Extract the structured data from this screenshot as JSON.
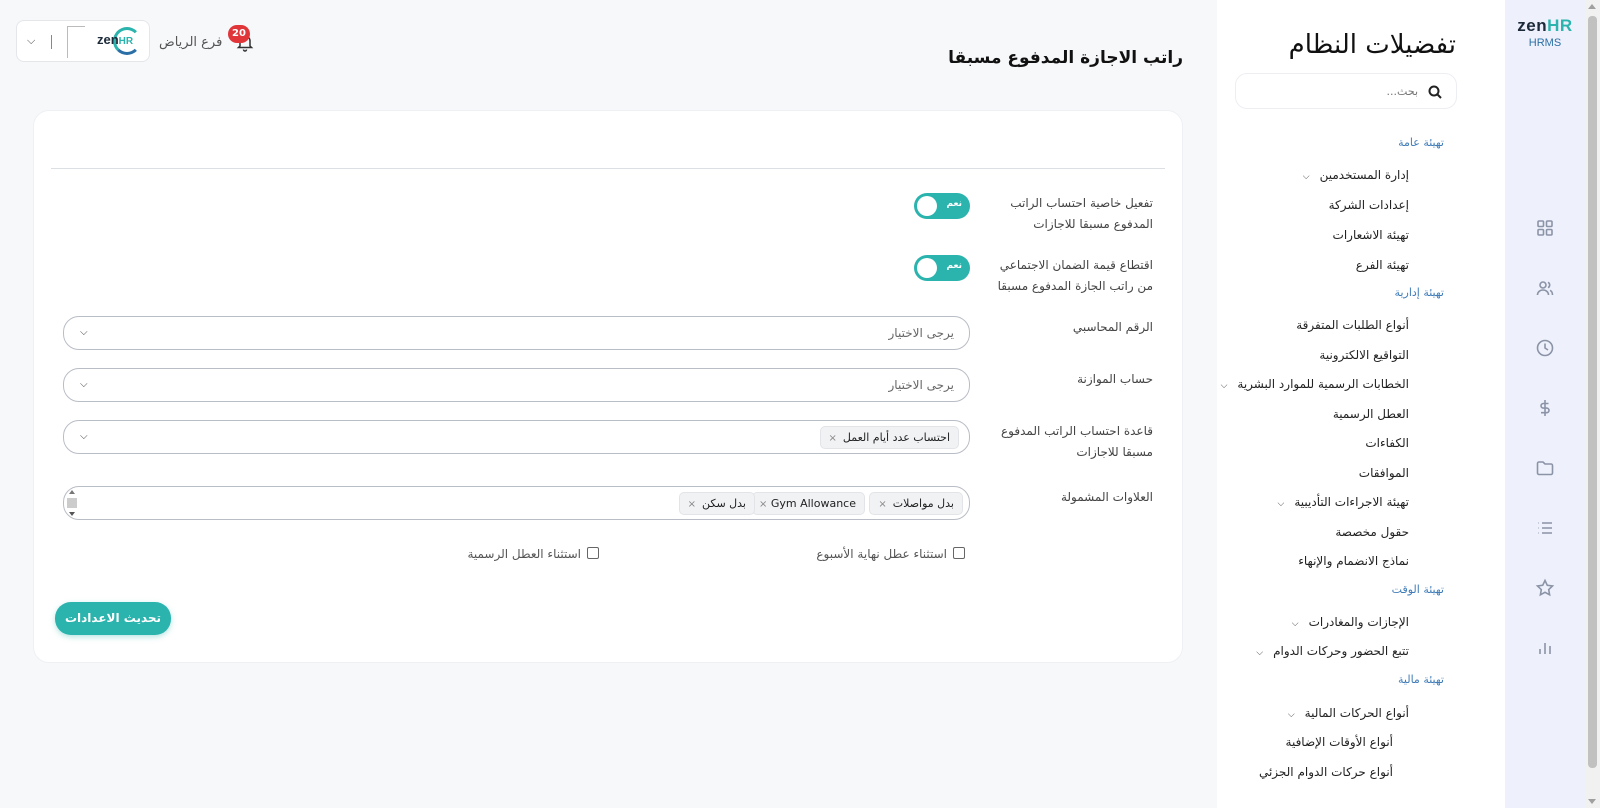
{
  "brand": {
    "logo_main": "zen",
    "logo_accent": "HR",
    "product": "HRMS"
  },
  "rail_icons": [
    "grid-icon",
    "users-icon",
    "clock-icon",
    "dollar-icon",
    "folder-icon",
    "list-icon",
    "star-icon",
    "bar-chart-icon"
  ],
  "settings": {
    "title": "تفضيلات النظام",
    "search_placeholder": "بحث...",
    "sections": [
      {
        "title": "تهيئة عامة",
        "items": [
          {
            "label": "إدارة المستخدمين",
            "expandable": true
          },
          {
            "label": "إعدادات الشركة",
            "expandable": false
          },
          {
            "label": "تهيئة الاشعارات",
            "expandable": false
          },
          {
            "label": "تهيئة الفرع",
            "expandable": false
          }
        ]
      },
      {
        "title": "تهيئة إدارية",
        "items": [
          {
            "label": "أنواع الطلبات المتفرقة",
            "expandable": false
          },
          {
            "label": "التواقيع الالكترونية",
            "expandable": false
          },
          {
            "label": "الخطابات الرسمية للموارد البشرية",
            "expandable": true
          },
          {
            "label": "العطل الرسمية",
            "expandable": false
          },
          {
            "label": "الكفاءات",
            "expandable": false
          },
          {
            "label": "الموافقات",
            "expandable": false
          },
          {
            "label": "تهيئة الاجراءات التأديبية",
            "expandable": true
          },
          {
            "label": "حقول مخصصة",
            "expandable": false
          },
          {
            "label": "نماذج الانضمام والإنهاء",
            "expandable": false
          }
        ]
      },
      {
        "title": "تهيئة الوقت",
        "items": [
          {
            "label": "الإجازات والمغادرات",
            "expandable": true
          },
          {
            "label": "تتبع الحضور وحركات الدوام",
            "expandable": true
          }
        ]
      },
      {
        "title": "تهيئة مالية",
        "items": [
          {
            "label": "أنواع الحركات المالية",
            "expandable": true
          },
          {
            "label": "أنواع الأوقات الإضافية",
            "expandable": false
          },
          {
            "label": "أنواع حركات الدوام الجزئي",
            "expandable": false
          }
        ]
      }
    ]
  },
  "header": {
    "page_title": "راتب الاجازة المدفوع مسبقا",
    "branch": "فرع الرياض",
    "notifications_count": "20",
    "company_logo_main": "zen",
    "company_logo_accent": "HR"
  },
  "form": {
    "toggle_1": {
      "label": "تفعيل خاصية احتساب الراتب المدفوع مسبقا للاجازات",
      "state_text": "نعم",
      "on": true
    },
    "toggle_2": {
      "label": "اقتطاع قيمة الضمان الاجتماعي من راتب الجازة المدفوع مسبقا",
      "state_text": "نعم",
      "on": true
    },
    "accounting_number": {
      "label": "الرقم المحاسبي",
      "placeholder": "يرجى الاختيار"
    },
    "budget_account": {
      "label": "حساب الموازنة",
      "placeholder": "يرجى الاختيار"
    },
    "calc_basis": {
      "label": "قاعدة احتساب الراتب المدفوع مسبقا للاجازات",
      "selected": [
        "احتساب عدد أيام العمل"
      ]
    },
    "allowances": {
      "label": "العلاوات المشمولة",
      "selected": [
        "بدل مواصلات",
        "Gym Allowance",
        "بدل سكن"
      ]
    },
    "exclude_weekends": {
      "label": "استثناء عطل نهاية الأسبوع",
      "checked": false
    },
    "exclude_holidays": {
      "label": "استثناء العطل الرسمية",
      "checked": false
    },
    "submit_label": "تحديث الاعدادات"
  },
  "colors": {
    "accent": "#2bb3ad",
    "badge": "#e0363a",
    "rail_bg": "#eef1fb",
    "section_title": "#3f7cb8"
  }
}
